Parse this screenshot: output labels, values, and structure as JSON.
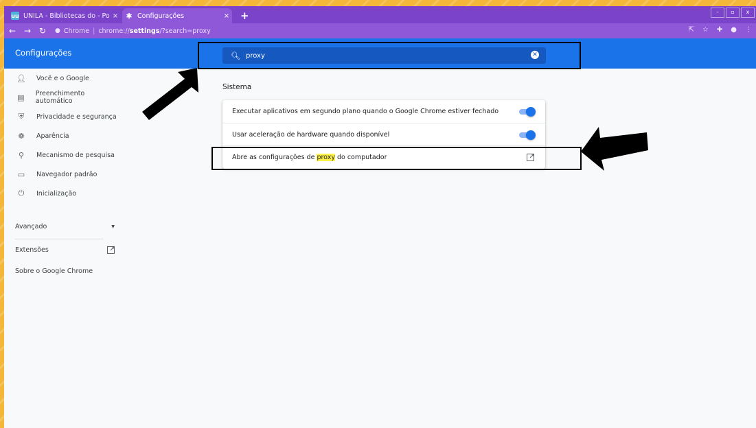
{
  "tabs": [
    {
      "favicon": "uu",
      "title": "UNILA - Bibliotecas do - Portada",
      "close": "×"
    },
    {
      "favicon": "gear-icon",
      "title": "Configurações",
      "close": "×"
    }
  ],
  "new_tab": "+",
  "window_controls": [
    "–",
    "▫",
    "x"
  ],
  "address_bar": {
    "site_label": "Chrome",
    "url_scheme": "chrome://",
    "url_host": "settings",
    "url_path": "/?search=proxy"
  },
  "settings": {
    "title": "Configurações",
    "search_value": "proxy"
  },
  "sidebar": {
    "items": [
      {
        "icon": "person-icon",
        "label": "Você e o Google"
      },
      {
        "icon": "clipboard-icon",
        "label": "Preenchimento automático"
      },
      {
        "icon": "shield-icon",
        "label": "Privacidade e segurança"
      },
      {
        "icon": "palette-icon",
        "label": "Aparência"
      },
      {
        "icon": "search-icon",
        "label": "Mecanismo de pesquisa"
      },
      {
        "icon": "browser-icon",
        "label": "Navegador padrão"
      },
      {
        "icon": "power-icon",
        "label": "Inicialização"
      }
    ],
    "advanced": "Avançado",
    "extensions": "Extensões",
    "about": "Sobre o Google Chrome"
  },
  "main": {
    "section_title": "Sistema",
    "rows": [
      {
        "label": "Executar aplicativos em segundo plano quando o Google Chrome estiver fechado",
        "toggle_on": true
      },
      {
        "label": "Usar aceleração de hardware quando disponível",
        "toggle_on": true
      },
      {
        "label_before": "Abre as configurações de ",
        "label_highlight": "proxy",
        "label_after": " do computador"
      }
    ]
  },
  "colors": {
    "accent": "#1a73e8",
    "titlebar": "#7b43c9",
    "background_frame": "#f4b73a",
    "highlight": "#fff34a"
  }
}
